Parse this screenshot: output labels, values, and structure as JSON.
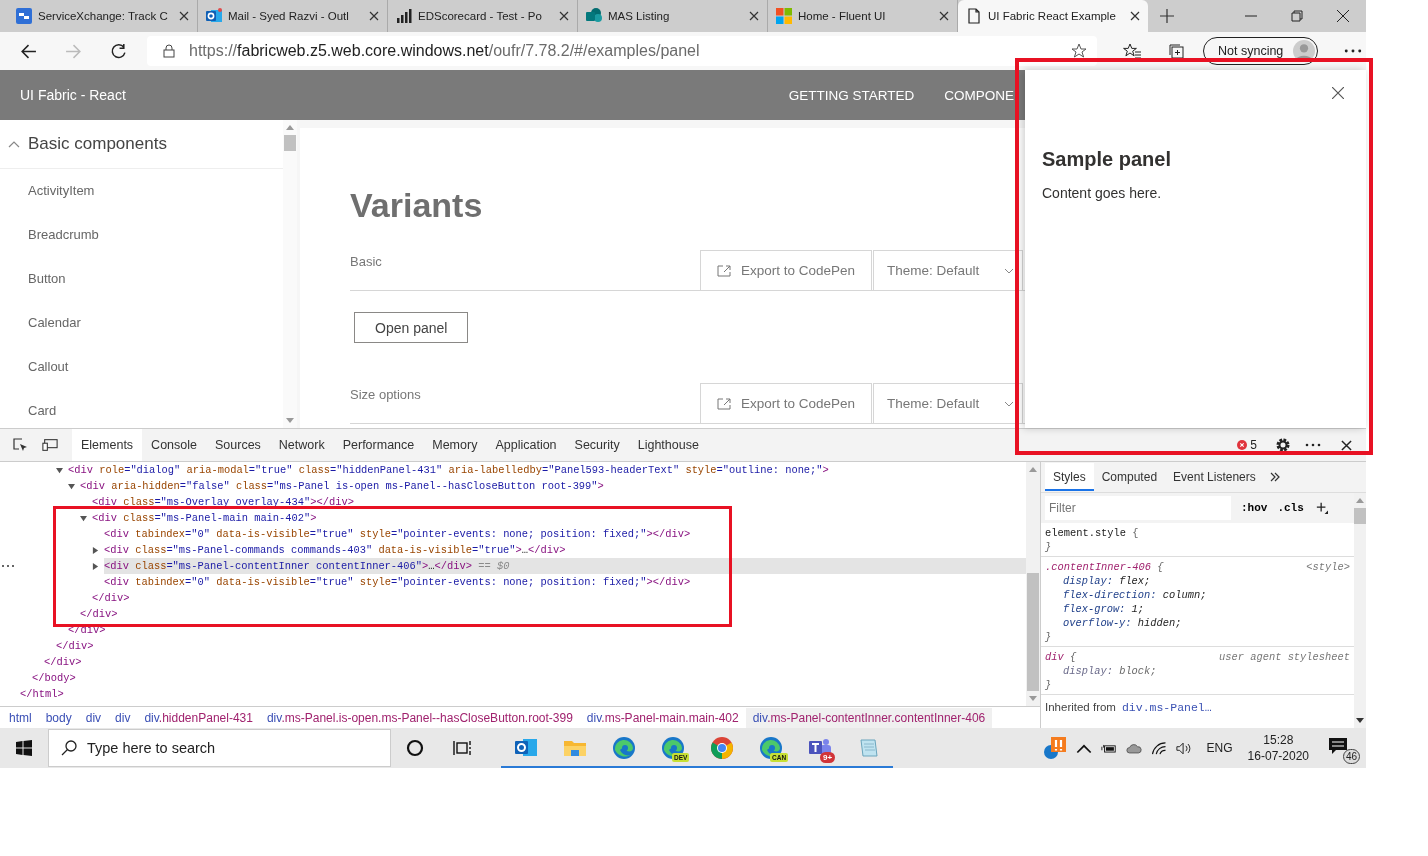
{
  "browser": {
    "tabs": [
      {
        "kind": "servicexchange",
        "label": "ServiceXchange: Track C",
        "selected": false
      },
      {
        "kind": "outlook",
        "label": "Mail - Syed Razvi - Outl",
        "selected": false
      },
      {
        "kind": "chart",
        "label": "EDScorecard - Test - Po",
        "selected": false
      },
      {
        "kind": "sharepoint",
        "label": "MAS Listing",
        "selected": false
      },
      {
        "kind": "windows",
        "label": "Home - Fluent UI",
        "selected": false
      },
      {
        "kind": "page",
        "label": "UI Fabric React Example",
        "selected": true
      }
    ],
    "nav": {
      "back_disabled": false,
      "forward_disabled": true
    },
    "address": {
      "scheme": "https://",
      "host": "fabricweb.z5.web.core.windows.net",
      "path": "/oufr/7.78.2/#/examples/panel"
    },
    "profile": "Not syncing"
  },
  "site": {
    "brand": "UI Fabric - React",
    "nav": [
      "GETTING STARTED",
      "COMPONE"
    ],
    "sidebar": {
      "section": "Basic components",
      "expanded": true,
      "items": [
        "ActivityItem",
        "Breadcrumb",
        "Button",
        "Calendar",
        "Callout",
        "Card"
      ]
    },
    "heading": "Variants",
    "examples": [
      {
        "label": "Basic",
        "export": "Export to CodePen",
        "theme": "Theme: Default",
        "action": "Open panel"
      },
      {
        "label": "Size options",
        "export": "Export to CodePen",
        "theme": "Theme: Default"
      }
    ]
  },
  "panel": {
    "title": "Sample panel",
    "body": "Content goes here."
  },
  "devtools": {
    "tabs": [
      {
        "label": "Elements",
        "selected": true
      },
      {
        "label": "Console",
        "selected": false
      },
      {
        "label": "Sources",
        "selected": false
      },
      {
        "label": "Network",
        "selected": false
      },
      {
        "label": "Performance",
        "selected": false
      },
      {
        "label": "Memory",
        "selected": false
      },
      {
        "label": "Application",
        "selected": false
      },
      {
        "label": "Security",
        "selected": false
      },
      {
        "label": "Lighthouse",
        "selected": false
      }
    ],
    "errors": "5",
    "dom_tree": [
      {
        "close": [
          {
            "t": "</html>",
            "kind": "tag"
          }
        ],
        "children": [
          {
            "close": [
              {
                "t": "</body>",
                "kind": "tag"
              }
            ],
            "children": [
              {
                "close": [
                  {
                    "t": "</div>",
                    "kind": "tag"
                  }
                ],
                "children": [
                  {
                    "close": [
                      {
                        "t": "</div>",
                        "kind": "tag"
                      }
                    ],
                    "children": [
                      {
                        "open": [
                          {
                            "t": "<div",
                            "kind": "tag"
                          },
                          {
                            "t": " role",
                            "kind": "attr"
                          },
                          {
                            "t": "=\"dialog\"",
                            "kind": "val"
                          },
                          {
                            "t": " aria-modal",
                            "kind": "attr"
                          },
                          {
                            "t": "=\"true\"",
                            "kind": "val"
                          },
                          {
                            "t": " class",
                            "kind": "attr"
                          },
                          {
                            "t": "=\"hiddenPanel-431\"",
                            "kind": "val"
                          },
                          {
                            "t": " aria-labelledby",
                            "kind": "attr"
                          },
                          {
                            "t": "=\"Panel593-headerText\"",
                            "kind": "val"
                          },
                          {
                            "t": " style",
                            "kind": "attr"
                          },
                          {
                            "t": "=\"outline: none;\"",
                            "kind": "val"
                          },
                          {
                            "t": ">",
                            "kind": "tag"
                          }
                        ],
                        "expanded": true,
                        "selected": false,
                        "close": [
                          {
                            "t": "</div>",
                            "kind": "tag"
                          }
                        ],
                        "children": [
                          {
                            "open": [
                              {
                                "t": "<div",
                                "kind": "tag"
                              },
                              {
                                "t": " aria-hidden",
                                "kind": "attr"
                              },
                              {
                                "t": "=\"false\"",
                                "kind": "val"
                              },
                              {
                                "t": " class",
                                "kind": "attr"
                              },
                              {
                                "t": "=\"ms-Panel is-open ms-Panel--hasCloseButton root-399\"",
                                "kind": "val"
                              },
                              {
                                "t": ">",
                                "kind": "tag"
                              }
                            ],
                            "expanded": true,
                            "selected": false,
                            "close": [
                              {
                                "t": "</div>",
                                "kind": "tag"
                              }
                            ],
                            "children": [
                              {
                                "open": [
                                  {
                                    "t": "<div",
                                    "kind": "tag"
                                  },
                                  {
                                    "t": " class",
                                    "kind": "attr"
                                  },
                                  {
                                    "t": "=\"ms-Overlay overlay-434\"",
                                    "kind": "val"
                                  },
                                  {
                                    "t": "></div>",
                                    "kind": "tag"
                                  }
                                ],
                                "selected": false
                              },
                              {
                                "open": [
                                  {
                                    "t": "<div",
                                    "kind": "tag"
                                  },
                                  {
                                    "t": " class",
                                    "kind": "attr"
                                  },
                                  {
                                    "t": "=\"ms-Panel-main main-402\"",
                                    "kind": "val"
                                  },
                                  {
                                    "t": ">",
                                    "kind": "tag"
                                  }
                                ],
                                "expanded": true,
                                "selected": false,
                                "close": [
                                  {
                                    "t": "</div>",
                                    "kind": "tag"
                                  }
                                ],
                                "children": [
                                  {
                                    "open": [
                                      {
                                        "t": "<div",
                                        "kind": "tag"
                                      },
                                      {
                                        "t": " tabindex",
                                        "kind": "attr"
                                      },
                                      {
                                        "t": "=\"0\"",
                                        "kind": "val"
                                      },
                                      {
                                        "t": " data-is-visible",
                                        "kind": "attr"
                                      },
                                      {
                                        "t": "=\"true\"",
                                        "kind": "val"
                                      },
                                      {
                                        "t": " style",
                                        "kind": "attr"
                                      },
                                      {
                                        "t": "=\"pointer-events: none; position: fixed;\"",
                                        "kind": "val"
                                      },
                                      {
                                        "t": "></div>",
                                        "kind": "tag"
                                      }
                                    ],
                                    "selected": false
                                  },
                                  {
                                    "open": [
                                      {
                                        "t": "<div",
                                        "kind": "tag"
                                      },
                                      {
                                        "t": " class",
                                        "kind": "attr"
                                      },
                                      {
                                        "t": "=\"ms-Panel-commands commands-403\"",
                                        "kind": "val"
                                      },
                                      {
                                        "t": " data-is-visible",
                                        "kind": "attr"
                                      },
                                      {
                                        "t": "=\"true\"",
                                        "kind": "val"
                                      },
                                      {
                                        "t": ">",
                                        "kind": "tag"
                                      },
                                      {
                                        "t": "…",
                                        "kind": "plain"
                                      },
                                      {
                                        "t": "</div>",
                                        "kind": "tag"
                                      }
                                    ],
                                    "expanded": false,
                                    "selected": false
                                  },
                                  {
                                    "open": [
                                      {
                                        "t": "<div",
                                        "kind": "tag"
                                      },
                                      {
                                        "t": " class",
                                        "kind": "attr"
                                      },
                                      {
                                        "t": "=\"ms-Panel-contentInner contentInner-406\"",
                                        "kind": "val"
                                      },
                                      {
                                        "t": ">",
                                        "kind": "tag"
                                      },
                                      {
                                        "t": "…",
                                        "kind": "plain"
                                      },
                                      {
                                        "t": "</div>",
                                        "kind": "tag"
                                      },
                                      {
                                        "t": " == $0",
                                        "kind": "note"
                                      }
                                    ],
                                    "expanded": false,
                                    "selected": true
                                  },
                                  {
                                    "open": [
                                      {
                                        "t": "<div",
                                        "kind": "tag"
                                      },
                                      {
                                        "t": " tabindex",
                                        "kind": "attr"
                                      },
                                      {
                                        "t": "=\"0\"",
                                        "kind": "val"
                                      },
                                      {
                                        "t": " data-is-visible",
                                        "kind": "attr"
                                      },
                                      {
                                        "t": "=\"true\"",
                                        "kind": "val"
                                      },
                                      {
                                        "t": " style",
                                        "kind": "attr"
                                      },
                                      {
                                        "t": "=\"pointer-events: none; position: fixed;\"",
                                        "kind": "val"
                                      },
                                      {
                                        "t": "></div>",
                                        "kind": "tag"
                                      }
                                    ],
                                    "selected": false
                                  }
                                ]
                              }
                            ]
                          }
                        ]
                      }
                    ]
                  }
                ]
              }
            ]
          }
        ]
      }
    ],
    "breadcrumb": [
      {
        "tag": "html",
        "selected": false
      },
      {
        "tag": "body",
        "selected": false
      },
      {
        "tag": "div",
        "selected": false
      },
      {
        "tag": "div",
        "selected": false
      },
      {
        "tag": "div",
        "classes": ".hiddenPanel-431",
        "selected": false
      },
      {
        "tag": "div",
        "classes": ".ms-Panel.is-open.ms-Panel--hasCloseButton.root-399",
        "selected": false
      },
      {
        "tag": "div",
        "classes": ".ms-Panel-main.main-402",
        "selected": false
      },
      {
        "tag": "div",
        "classes": ".ms-Panel-contentInner.contentInner-406",
        "selected": true
      }
    ],
    "styles": {
      "tabs": [
        {
          "label": "Styles",
          "selected": true
        },
        {
          "label": "Computed",
          "selected": false
        },
        {
          "label": "Event Listeners",
          "selected": false
        }
      ],
      "filter_placeholder": "Filter",
      "toggles": [
        ":hov",
        ".cls"
      ],
      "rules": [
        {
          "kind": "inline",
          "selector": "element.style",
          "open": "{",
          "close": "}"
        },
        {
          "kind": "stylesheet",
          "selector": ".contentInner-406",
          "open": "{",
          "source": "<style>",
          "close": "}",
          "declarations": [
            {
              "name": "display:",
              "value": "flex;",
              "overridden": false
            },
            {
              "name": "flex-direction:",
              "value": "column;",
              "overridden": false
            },
            {
              "name": "flex-grow:",
              "value": "1;",
              "overridden": false
            },
            {
              "name": "overflow-y:",
              "value": "hidden;",
              "overridden": false
            }
          ]
        },
        {
          "kind": "user-agent",
          "selector": "div",
          "open": "{",
          "source": "user agent stylesheet",
          "close": "}",
          "declarations": [
            {
              "name": "display:",
              "value": "block;",
              "overridden": true
            }
          ]
        }
      ],
      "inherited": {
        "label": "Inherited from",
        "link": "div.ms-Panel…"
      }
    }
  },
  "taskbar": {
    "search_placeholder": "Type here to search",
    "apps": [
      {
        "kind": "outlook"
      },
      {
        "kind": "explorer"
      },
      {
        "kind": "edge"
      },
      {
        "kind": "edge",
        "badge": "DEV"
      },
      {
        "kind": "chrome"
      },
      {
        "kind": "edge",
        "badge": "CAN"
      },
      {
        "kind": "teams",
        "badge": "9+"
      },
      {
        "kind": "notepad"
      }
    ],
    "tray": {
      "language": "ENG",
      "time": "15:28",
      "date": "16-07-2020",
      "notifications": "46"
    }
  }
}
